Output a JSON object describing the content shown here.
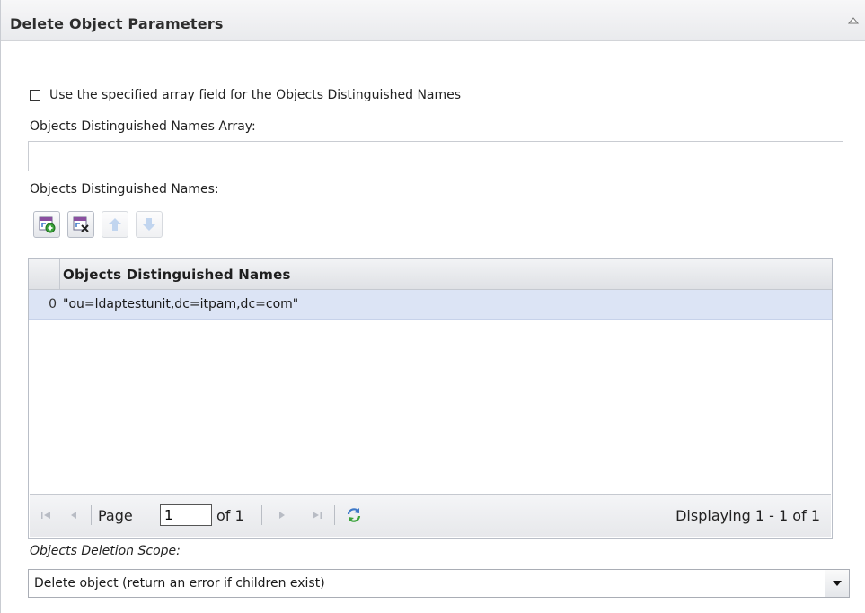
{
  "panel": {
    "title": "Delete Object Parameters"
  },
  "use_array": {
    "label": "Use the specified array field for the Objects Distinguished Names",
    "checked": false
  },
  "array_field": {
    "label": "Objects Distinguished Names Array:",
    "value": ""
  },
  "names": {
    "label": "Objects Distinguished Names:",
    "toolbar": [
      "add-row-icon",
      "delete-row-icon",
      "move-up-icon",
      "move-down-icon"
    ],
    "column_header": "Objects Distinguished Names",
    "rows": [
      {
        "index": "0",
        "value": "\"ou=ldaptestunit,dc=itpam,dc=com\""
      }
    ]
  },
  "pager": {
    "page_label": "Page",
    "page_value": "1",
    "of_label": "of 1",
    "displaying": "Displaying 1 - 1 of 1"
  },
  "scope": {
    "label": "Objects Deletion Scope:",
    "selected": "Delete object (return an error if children exist)"
  },
  "colors": {
    "row_selected": "#dce4f5",
    "accent": "#3d78c8"
  }
}
